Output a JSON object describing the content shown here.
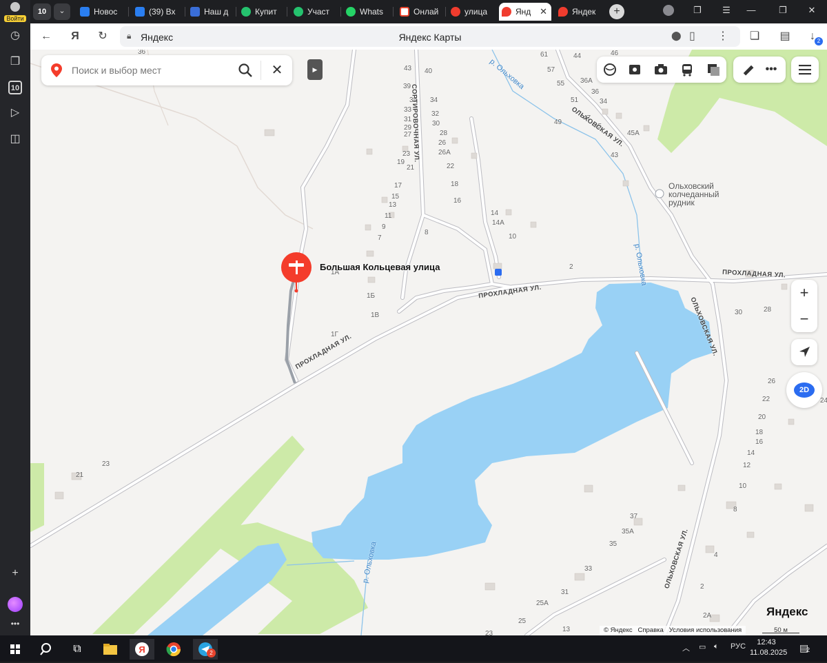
{
  "sidebar": {
    "login_label": "Войти",
    "tab_count_badge": "10"
  },
  "tabstrip": {
    "tab_count": "10",
    "tabs": [
      {
        "label": "Новос",
        "color": "#2a7ef0"
      },
      {
        "label": "(39) Вх",
        "color": "#2a7ef0"
      },
      {
        "label": "Наш д",
        "color": "#3a6ed8"
      },
      {
        "label": "Купит",
        "color": "#25c26e"
      },
      {
        "label": "Участ",
        "color": "#25c26e"
      },
      {
        "label": "Whats",
        "color": "#25d366"
      },
      {
        "label": "Онлай",
        "color": "#e8442e"
      },
      {
        "label": "улица",
        "color": "#f03c2e"
      },
      {
        "label": "Янд",
        "color": "#f03c2e",
        "active": true
      },
      {
        "label": "Яндек",
        "color": "#f03c2e"
      }
    ],
    "new_tab": "+",
    "download_badge": "2"
  },
  "toolbar": {
    "domain": "Яндекс",
    "page_title": "Яндекс Карты"
  },
  "map": {
    "search_placeholder": "Поиск и выбор мест",
    "selected_place": "Большая Кольцевая улица",
    "poi": "Ольховский колчеданный рудник",
    "streets": {
      "prokhladnaya": "ПРОХЛАДНАЯ УЛ.",
      "olkhovskaya": "ОЛЬХОВСКАЯ УЛ.",
      "sortirovochnaya": "СОРТИРОВОЧНАЯ УЛ."
    },
    "river": "р. Ольховка",
    "houses": [
      {
        "n": "36"
      },
      {
        "n": "43"
      },
      {
        "n": "40"
      },
      {
        "n": "39"
      },
      {
        "n": "35"
      },
      {
        "n": "34"
      },
      {
        "n": "33"
      },
      {
        "n": "32"
      },
      {
        "n": "31"
      },
      {
        "n": "30"
      },
      {
        "n": "29"
      },
      {
        "n": "28"
      },
      {
        "n": "27"
      },
      {
        "n": "26"
      },
      {
        "n": "23"
      },
      {
        "n": "26А"
      },
      {
        "n": "19"
      },
      {
        "n": "21"
      },
      {
        "n": "22"
      },
      {
        "n": "17"
      },
      {
        "n": "18"
      },
      {
        "n": "15"
      },
      {
        "n": "16"
      },
      {
        "n": "13"
      },
      {
        "n": "11"
      },
      {
        "n": "9"
      },
      {
        "n": "7"
      },
      {
        "n": "8"
      },
      {
        "n": "14"
      },
      {
        "n": "14А"
      },
      {
        "n": "10"
      },
      {
        "n": "1А"
      },
      {
        "n": "1Б"
      },
      {
        "n": "1В"
      },
      {
        "n": "1Г"
      },
      {
        "n": "2"
      },
      {
        "n": "61"
      },
      {
        "n": "57"
      },
      {
        "n": "55"
      },
      {
        "n": "44"
      },
      {
        "n": "46"
      },
      {
        "n": "36А"
      },
      {
        "n": "36"
      },
      {
        "n": "51"
      },
      {
        "n": "34"
      },
      {
        "n": "47"
      },
      {
        "n": "45"
      },
      {
        "n": "49"
      },
      {
        "n": "45А"
      },
      {
        "n": "43"
      },
      {
        "n": "30"
      },
      {
        "n": "28"
      },
      {
        "n": "26"
      },
      {
        "n": "22"
      },
      {
        "n": "24"
      },
      {
        "n": "20"
      },
      {
        "n": "18"
      },
      {
        "n": "16"
      },
      {
        "n": "14"
      },
      {
        "n": "12"
      },
      {
        "n": "10"
      },
      {
        "n": "8"
      },
      {
        "n": "37"
      },
      {
        "n": "35А"
      },
      {
        "n": "35"
      },
      {
        "n": "4"
      },
      {
        "n": "33"
      },
      {
        "n": "31"
      },
      {
        "n": "2"
      },
      {
        "n": "25А"
      },
      {
        "n": "25"
      },
      {
        "n": "2А"
      },
      {
        "n": "13"
      },
      {
        "n": "23"
      },
      {
        "n": "21"
      },
      {
        "n": "23"
      }
    ],
    "brand": "Яндекс",
    "copyright": "© Яндекс",
    "help_link": "Справка",
    "terms_link": "Условия использования",
    "scale": "50 м",
    "view_mode": "2D",
    "zoom_in": "+",
    "zoom_out": "−"
  },
  "taskbar": {
    "lang": "РУС",
    "time": "12:43",
    "date": "11.08.2025",
    "notifications": "2",
    "telegram_badge": "2"
  },
  "colors": {
    "water": "#99d1f5",
    "park": "#cdeaa8",
    "road": "#ffffff",
    "road_outline": "#bcbcc2",
    "marker": "#f43c2b",
    "active_tab": "#ffffff"
  }
}
